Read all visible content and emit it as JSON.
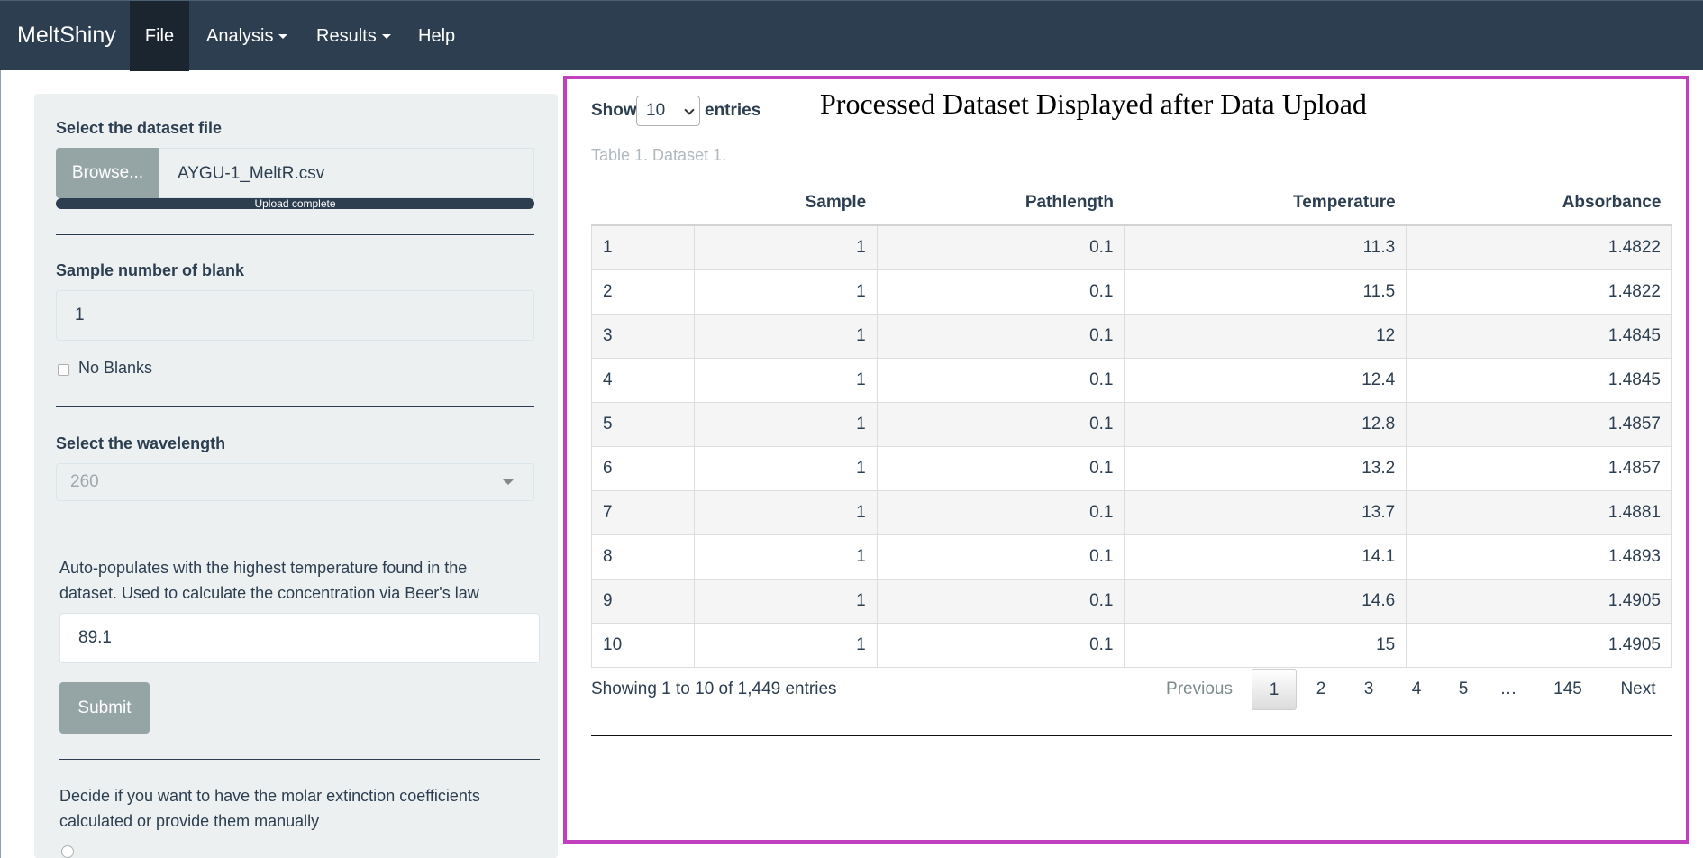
{
  "navbar": {
    "brand": "MeltShiny",
    "items": [
      {
        "label": "File",
        "active": true
      },
      {
        "label": "Analysis",
        "dropdown": true
      },
      {
        "label": "Results",
        "dropdown": true
      },
      {
        "label": "Help"
      }
    ]
  },
  "sidebar": {
    "dataset": {
      "label": "Select the dataset file",
      "browse_label": "Browse...",
      "filename": "AYGU-1_MeltR.csv",
      "progress_text": "Upload complete"
    },
    "blank": {
      "label": "Sample number of blank",
      "value": "1",
      "checkbox_label": "No Blanks",
      "checked": false
    },
    "wavelength": {
      "label": "Select the wavelength",
      "value": "260"
    },
    "temperature": {
      "help": "Auto-populates with the highest temperature found in the dataset. Used to calculate the concentration via Beer's law",
      "value": "89.1",
      "submit_label": "Submit"
    },
    "extinction": {
      "help": "Decide if you want to have the molar extinction coefficients calculated or provide them manually"
    }
  },
  "main": {
    "overlay_title": "Processed Dataset Displayed after Data Upload",
    "length": {
      "show_label": "Show",
      "value": "10",
      "entries_label": "entries"
    },
    "caption": "Table 1. Dataset 1.",
    "table": {
      "columns": [
        "",
        "Sample",
        "Pathlength",
        "Temperature",
        "Absorbance"
      ],
      "rows": [
        [
          "1",
          "1",
          "0.1",
          "11.3",
          "1.4822"
        ],
        [
          "2",
          "1",
          "0.1",
          "11.5",
          "1.4822"
        ],
        [
          "3",
          "1",
          "0.1",
          "12",
          "1.4845"
        ],
        [
          "4",
          "1",
          "0.1",
          "12.4",
          "1.4845"
        ],
        [
          "5",
          "1",
          "0.1",
          "12.8",
          "1.4857"
        ],
        [
          "6",
          "1",
          "0.1",
          "13.2",
          "1.4857"
        ],
        [
          "7",
          "1",
          "0.1",
          "13.7",
          "1.4881"
        ],
        [
          "8",
          "1",
          "0.1",
          "14.1",
          "1.4893"
        ],
        [
          "9",
          "1",
          "0.1",
          "14.6",
          "1.4905"
        ],
        [
          "10",
          "1",
          "0.1",
          "15",
          "1.4905"
        ]
      ]
    },
    "info": "Showing 1 to 10 of 1,449 entries",
    "pagination": {
      "previous": "Previous",
      "pages": [
        "1",
        "2",
        "3",
        "4",
        "5",
        "…",
        "145"
      ],
      "current": "1",
      "next": "Next"
    }
  },
  "colors": {
    "navbar": "#2c3e50",
    "highlight_border": "#c040c0",
    "sidebar_bg": "#ecf0f1",
    "button": "#95a5a6"
  }
}
